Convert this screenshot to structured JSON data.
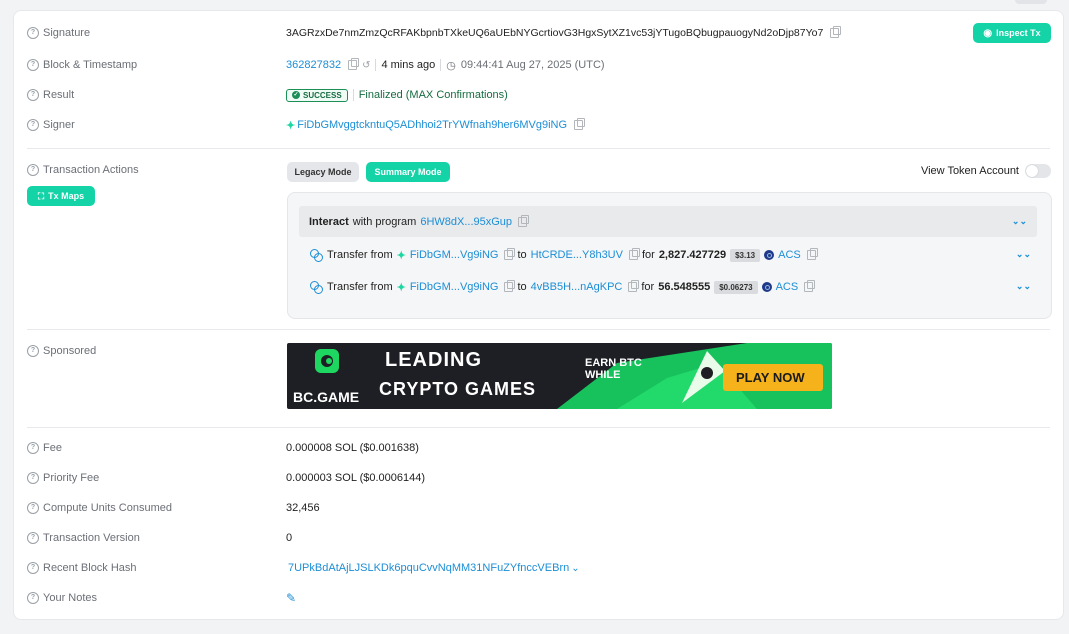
{
  "rows": {
    "signature": {
      "label": "Signature",
      "value": "3AGRzxDe7nmZmzQcRFAKbpnbTXkeUQ6aUEbNYGcrtiovG3HgxSytXZ1vc53jYTugoBQbugpauogyNd2oDjp87Yo7"
    },
    "block": {
      "label": "Block & Timestamp",
      "block": "362827832",
      "ago": "4 mins ago",
      "time": "09:44:41 Aug 27, 2025 (UTC)"
    },
    "result": {
      "label": "Result",
      "badge": "SUCCESS",
      "status": "Finalized (MAX Confirmations)"
    },
    "signer": {
      "label": "Signer",
      "value": "FiDbGMvggtckntuQ5ADhhoi2TrYWfnah9her6MVg9iNG"
    },
    "actions": {
      "label": "Transaction Actions"
    },
    "sponsored": {
      "label": "Sponsored"
    },
    "fee": {
      "label": "Fee",
      "value": "0.000008 SOL ($0.001638)"
    },
    "priority_fee": {
      "label": "Priority Fee",
      "value": "0.000003 SOL ($0.0006144)"
    },
    "compute_units": {
      "label": "Compute Units Consumed",
      "value": "32,456"
    },
    "version": {
      "label": "Transaction Version",
      "value": "0"
    },
    "recent_hash": {
      "label": "Recent Block Hash",
      "value": "7UPkBdAtAjLJSLKDk6pquCvvNqMM31NFuZYfnccVEBrn"
    },
    "notes": {
      "label": "Your Notes"
    }
  },
  "buttons": {
    "inspect": "Inspect Tx",
    "tx_maps": "Tx Maps",
    "legacy": "Legacy Mode",
    "summary": "Summary Mode",
    "view_token_account": "View Token Account"
  },
  "interact": {
    "prefix": "Interact",
    "middle": "with program",
    "program": "6HW8dX...95xGup"
  },
  "transfers": [
    {
      "text": "Transfer from",
      "from": "FiDbGM...Vg9iNG",
      "to_word": "to",
      "to": "HtCRDE...Y8h3UV",
      "for_word": "for",
      "amount": "2,827.427729",
      "usd": "$3.13",
      "token": "ACS"
    },
    {
      "text": "Transfer from",
      "from": "FiDbGM...Vg9iNG",
      "to_word": "to",
      "to": "4vBB5H...nAgKPC",
      "for_word": "for",
      "amount": "56.548555",
      "usd": "$0.06273",
      "token": "ACS"
    }
  ],
  "banner": {
    "brand": "BC.GAME",
    "line1": "LEADING",
    "line2": "CRYPTO GAMES",
    "promo": "EARN BTC WHILE",
    "cta": "PLAY NOW"
  },
  "colors": {
    "accent": "#14d3a7",
    "link": "#1c8ed6",
    "success": "#156c41"
  }
}
